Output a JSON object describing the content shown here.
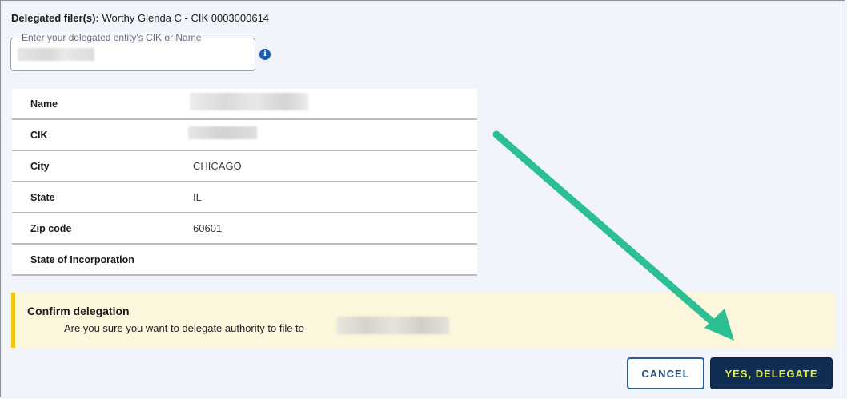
{
  "delegated": {
    "label": "Delegated filer(s):",
    "value": "Worthy Glenda C - CIK 0003000614"
  },
  "search": {
    "legend": "Enter your delegated entity's CIK or Name",
    "value": ""
  },
  "details": {
    "rows": [
      {
        "label": "Name",
        "value": ""
      },
      {
        "label": "CIK",
        "value": ""
      },
      {
        "label": "City",
        "value": "CHICAGO"
      },
      {
        "label": "State",
        "value": "IL"
      },
      {
        "label": "Zip code",
        "value": "60601"
      },
      {
        "label": "State of Incorporation",
        "value": ""
      }
    ]
  },
  "confirm": {
    "title": "Confirm delegation",
    "message": "Are you sure you want to delegate authority to file to"
  },
  "buttons": {
    "cancel": "CANCEL",
    "yes": "YES, DELEGATE"
  },
  "colors": {
    "arrow": "#2bbf93",
    "primary": "#0f2e52",
    "warning_border": "#f5c518"
  },
  "icons": {
    "info": "info-icon"
  }
}
